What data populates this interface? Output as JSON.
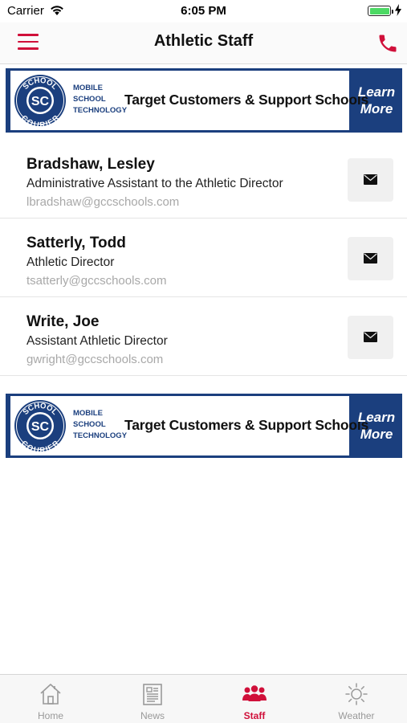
{
  "status_bar": {
    "carrier": "Carrier",
    "time": "6:05 PM",
    "battery_level": 1.0
  },
  "header": {
    "title": "Athletic Staff"
  },
  "ads": [
    {
      "logo_top": "SCHOOL",
      "logo_initials": "SC",
      "logo_bottom": "COURIER",
      "sub_lines": [
        "MOBILE",
        "SCHOOL",
        "TECHNOLOGY"
      ],
      "headline": "Target Customers & Support Schools",
      "cta_line1": "Learn",
      "cta_line2": "More"
    },
    {
      "logo_top": "SCHOOL",
      "logo_initials": "SC",
      "logo_bottom": "COURIER",
      "sub_lines": [
        "MOBILE",
        "SCHOOL",
        "TECHNOLOGY"
      ],
      "headline": "Target Customers & Support Schools",
      "cta_line1": "Learn",
      "cta_line2": "More"
    }
  ],
  "staff": [
    {
      "name": "Bradshaw, Lesley",
      "title": "Administrative Assistant to the Athletic Director",
      "email": "lbradshaw@gccschools.com"
    },
    {
      "name": "Satterly, Todd",
      "title": "Athletic Director",
      "email": "tsatterly@gccschools.com"
    },
    {
      "name": "Write, Joe",
      "title": "Assistant Athletic Director",
      "email": "gwright@gccschools.com"
    }
  ],
  "tabs": [
    {
      "label": "Home",
      "icon": "home-icon",
      "active": false
    },
    {
      "label": "News",
      "icon": "news-icon",
      "active": false
    },
    {
      "label": "Staff",
      "icon": "staff-icon",
      "active": true
    },
    {
      "label": "Weather",
      "icon": "weather-icon",
      "active": false
    }
  ],
  "colors": {
    "accent": "#d0103a",
    "ad_blue": "#1b3f7e",
    "email_gray": "#a8a8a8",
    "tab_inactive": "#999999",
    "battery_green": "#4cd964"
  }
}
